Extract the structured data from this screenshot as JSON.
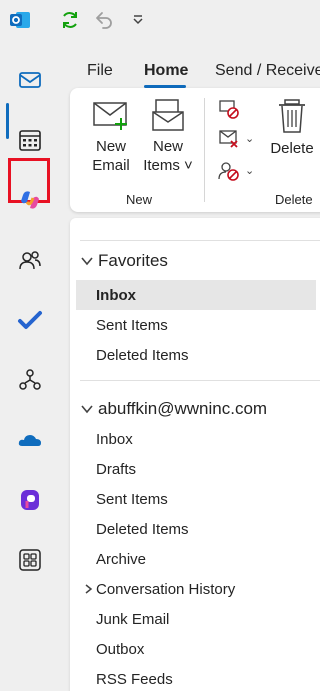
{
  "rail": {
    "items": [
      {
        "name": "mail-icon"
      },
      {
        "name": "calendar-icon"
      },
      {
        "name": "copilot-icon"
      },
      {
        "name": "people-icon"
      },
      {
        "name": "todo-icon"
      },
      {
        "name": "org-explorer-icon"
      },
      {
        "name": "onedrive-icon"
      },
      {
        "name": "loop-icon"
      },
      {
        "name": "apps-icon"
      }
    ]
  },
  "ribbon": {
    "tabs": [
      "File",
      "Home",
      "Send / Receive"
    ],
    "active_tab": "Home",
    "new_email": [
      "New",
      "Email"
    ],
    "new_items": [
      "New",
      "Items ˅"
    ],
    "group_new": "New",
    "delete_label": "Delete",
    "group_delete": "Delete"
  },
  "folders": {
    "favorites_label": "Favorites",
    "favorites": [
      "Inbox",
      "Sent Items",
      "Deleted Items"
    ],
    "account": "abuffkin@wwninc.com",
    "account_folders": [
      "Inbox",
      "Drafts",
      "Sent Items",
      "Deleted Items",
      "Archive",
      "Conversation History",
      "Junk Email",
      "Outbox",
      "RSS Feeds"
    ]
  },
  "colors": {
    "accent": "#0f6cbd",
    "highlight": "#e81123",
    "background": "#efefef"
  }
}
